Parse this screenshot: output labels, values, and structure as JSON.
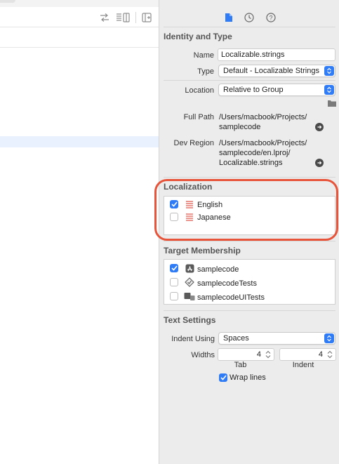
{
  "colors": {
    "accent": "#2f7cf6",
    "highlight": "#e8543a"
  },
  "inspector": {
    "tabs": [
      {
        "icon": "file-icon",
        "active": true
      },
      {
        "icon": "history-clock-icon",
        "active": false
      },
      {
        "icon": "help-question-icon",
        "active": false
      }
    ],
    "identity": {
      "title": "Identity and Type",
      "name_label": "Name",
      "name_value": "Localizable.strings",
      "type_label": "Type",
      "type_value": "Default - Localizable Strings",
      "location_label": "Location",
      "location_value": "Relative to Group",
      "fullpath_label": "Full Path",
      "fullpath_lines": [
        "/Users/macbook/Projects/",
        "samplecode"
      ],
      "devregion_label": "Dev Region",
      "devregion_lines": [
        "/Users/macbook/Projects/",
        "samplecode/en.lproj/",
        "Localizable.strings"
      ]
    },
    "localization": {
      "title": "Localization",
      "items": [
        {
          "label": "English",
          "checked": true
        },
        {
          "label": "Japanese",
          "checked": false
        }
      ]
    },
    "target_membership": {
      "title": "Target Membership",
      "items": [
        {
          "label": "samplecode",
          "checked": true,
          "icon": "app-store-icon"
        },
        {
          "label": "samplecodeTests",
          "checked": false,
          "icon": "test-diamond-icon"
        },
        {
          "label": "samplecodeUITests",
          "checked": false,
          "icon": "ui-test-icon"
        }
      ]
    },
    "text_settings": {
      "title": "Text Settings",
      "indent_label": "Indent Using",
      "indent_value": "Spaces",
      "widths_label": "Widths",
      "tab_value": "4",
      "tab_label": "Tab",
      "indent_width_value": "4",
      "indent_width_label": "Indent",
      "wrap_label": "Wrap lines",
      "wrap_checked": true
    }
  }
}
